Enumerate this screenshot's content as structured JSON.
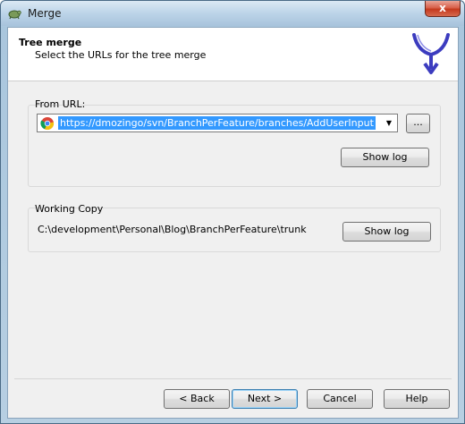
{
  "window": {
    "title": "Merge",
    "close_label": "x"
  },
  "header": {
    "title": "Tree merge",
    "subtitle": "Select the URLs for the tree merge"
  },
  "from_url": {
    "label": "From URL:",
    "value": "https://dmozingo/svn/BranchPerFeature/branches/AddUserInput",
    "browse_label": "...",
    "show_log_label": "Show log"
  },
  "working_copy": {
    "label": "Working Copy",
    "path": "C:\\development\\Personal\\Blog\\BranchPerFeature\\trunk",
    "show_log_label": "Show log"
  },
  "footer": {
    "back_label": "< Back",
    "next_label": "Next >",
    "cancel_label": "Cancel",
    "help_label": "Help"
  },
  "icons": {
    "title": "tortoise-icon",
    "logo": "merge-arrow-icon",
    "url": "browser-icon"
  },
  "colors": {
    "selection": "#3399ff",
    "logo": "#3c3cbf"
  }
}
